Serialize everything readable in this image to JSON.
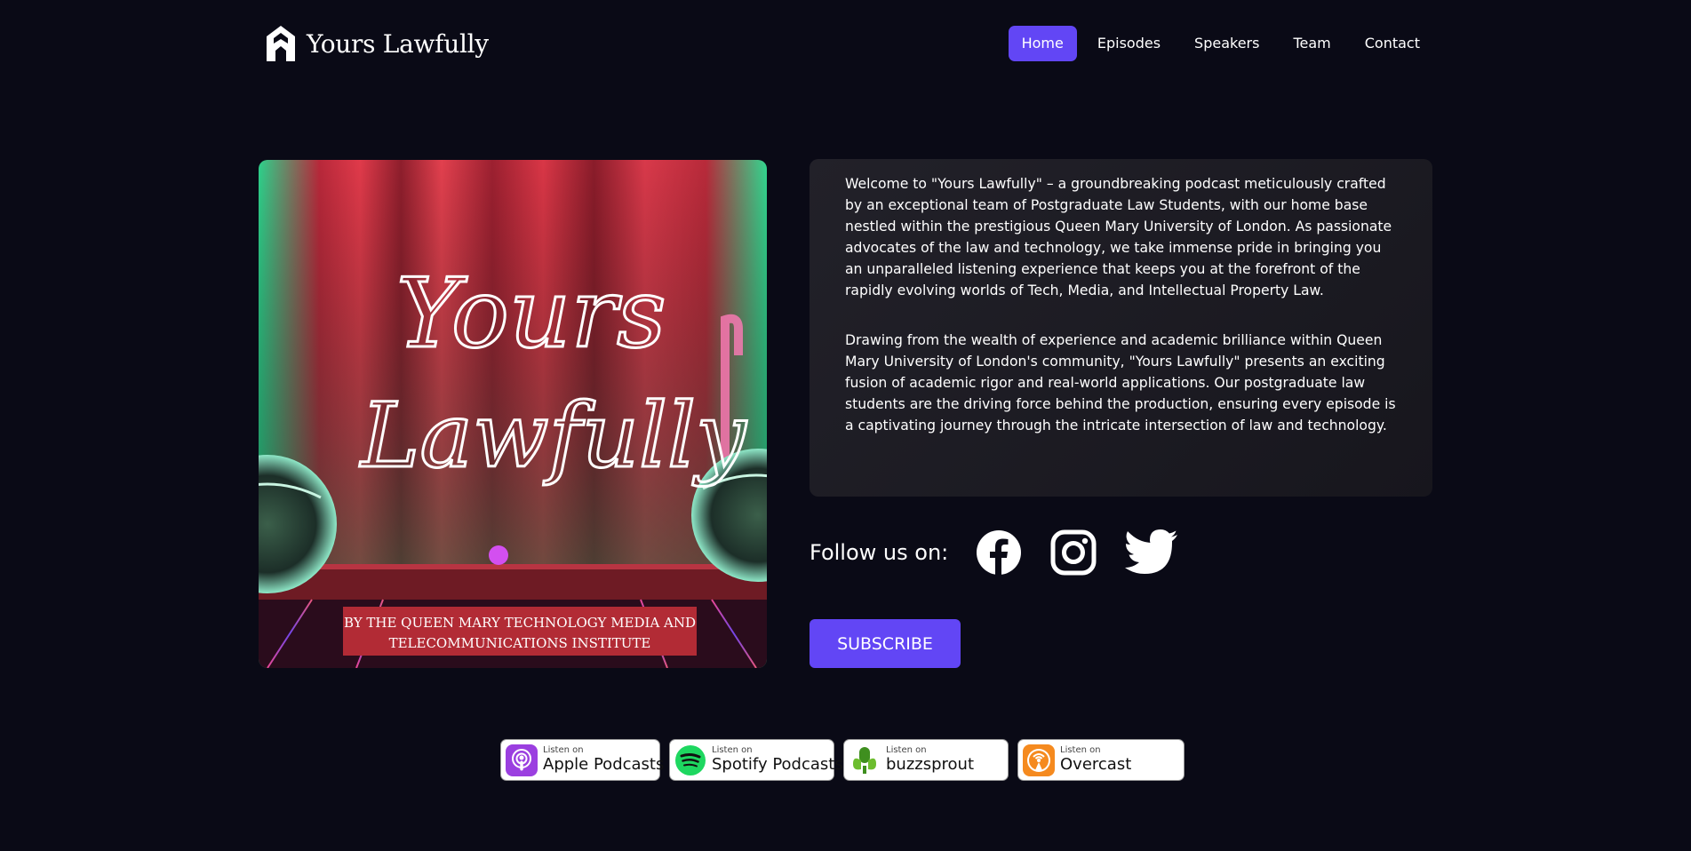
{
  "header": {
    "logo_text": "Yours Lawfully",
    "nav": [
      {
        "label": "Home",
        "active": true
      },
      {
        "label": "Episodes",
        "active": false
      },
      {
        "label": "Speakers",
        "active": false
      },
      {
        "label": "Team",
        "active": false
      },
      {
        "label": "Contact",
        "active": false
      }
    ]
  },
  "cover": {
    "script_line1": "Yours",
    "script_line2": "Lawfully",
    "banner_line1": "BY THE QUEEN MARY TECHNOLOGY MEDIA AND",
    "banner_line2": "TELECOMMUNICATIONS INSTITUTE"
  },
  "about": {
    "paragraph1": "Welcome to \"Yours Lawfully\" – a groundbreaking podcast meticulously crafted by an exceptional team of Postgraduate Law Students, with our home base nestled within the prestigious Queen Mary University of London. As passionate advocates of the law and technology, we take immense pride in bringing you an unparalleled listening experience that keeps you at the forefront of the rapidly evolving worlds of Tech, Media, and Intellectual Property Law.",
    "paragraph2": "Drawing from the wealth of experience and academic brilliance within Queen Mary University of London's community, \"Yours Lawfully\" presents an exciting fusion of academic rigor and real-world applications. Our postgraduate law students are the driving force behind the production, ensuring every episode is a captivating journey through the intricate intersection of law and technology."
  },
  "follow": {
    "label": "Follow us on:",
    "icons": [
      "facebook-icon",
      "instagram-icon",
      "twitter-icon"
    ]
  },
  "subscribe_label": "SUBSCRIBE",
  "badges": [
    {
      "small": "Listen on",
      "large": "Apple Podcasts",
      "icon": "apple-podcasts-icon"
    },
    {
      "small": "Listen on",
      "large": "Spotify Podcasts",
      "icon": "spotify-icon"
    },
    {
      "small": "Listen on",
      "large": "buzzsprout",
      "icon": "buzzsprout-icon"
    },
    {
      "small": "Listen on",
      "large": "Overcast",
      "icon": "overcast-icon"
    }
  ],
  "colors": {
    "background": "#0a0a16",
    "accent": "#6246f5",
    "card": "#1d1c23"
  }
}
